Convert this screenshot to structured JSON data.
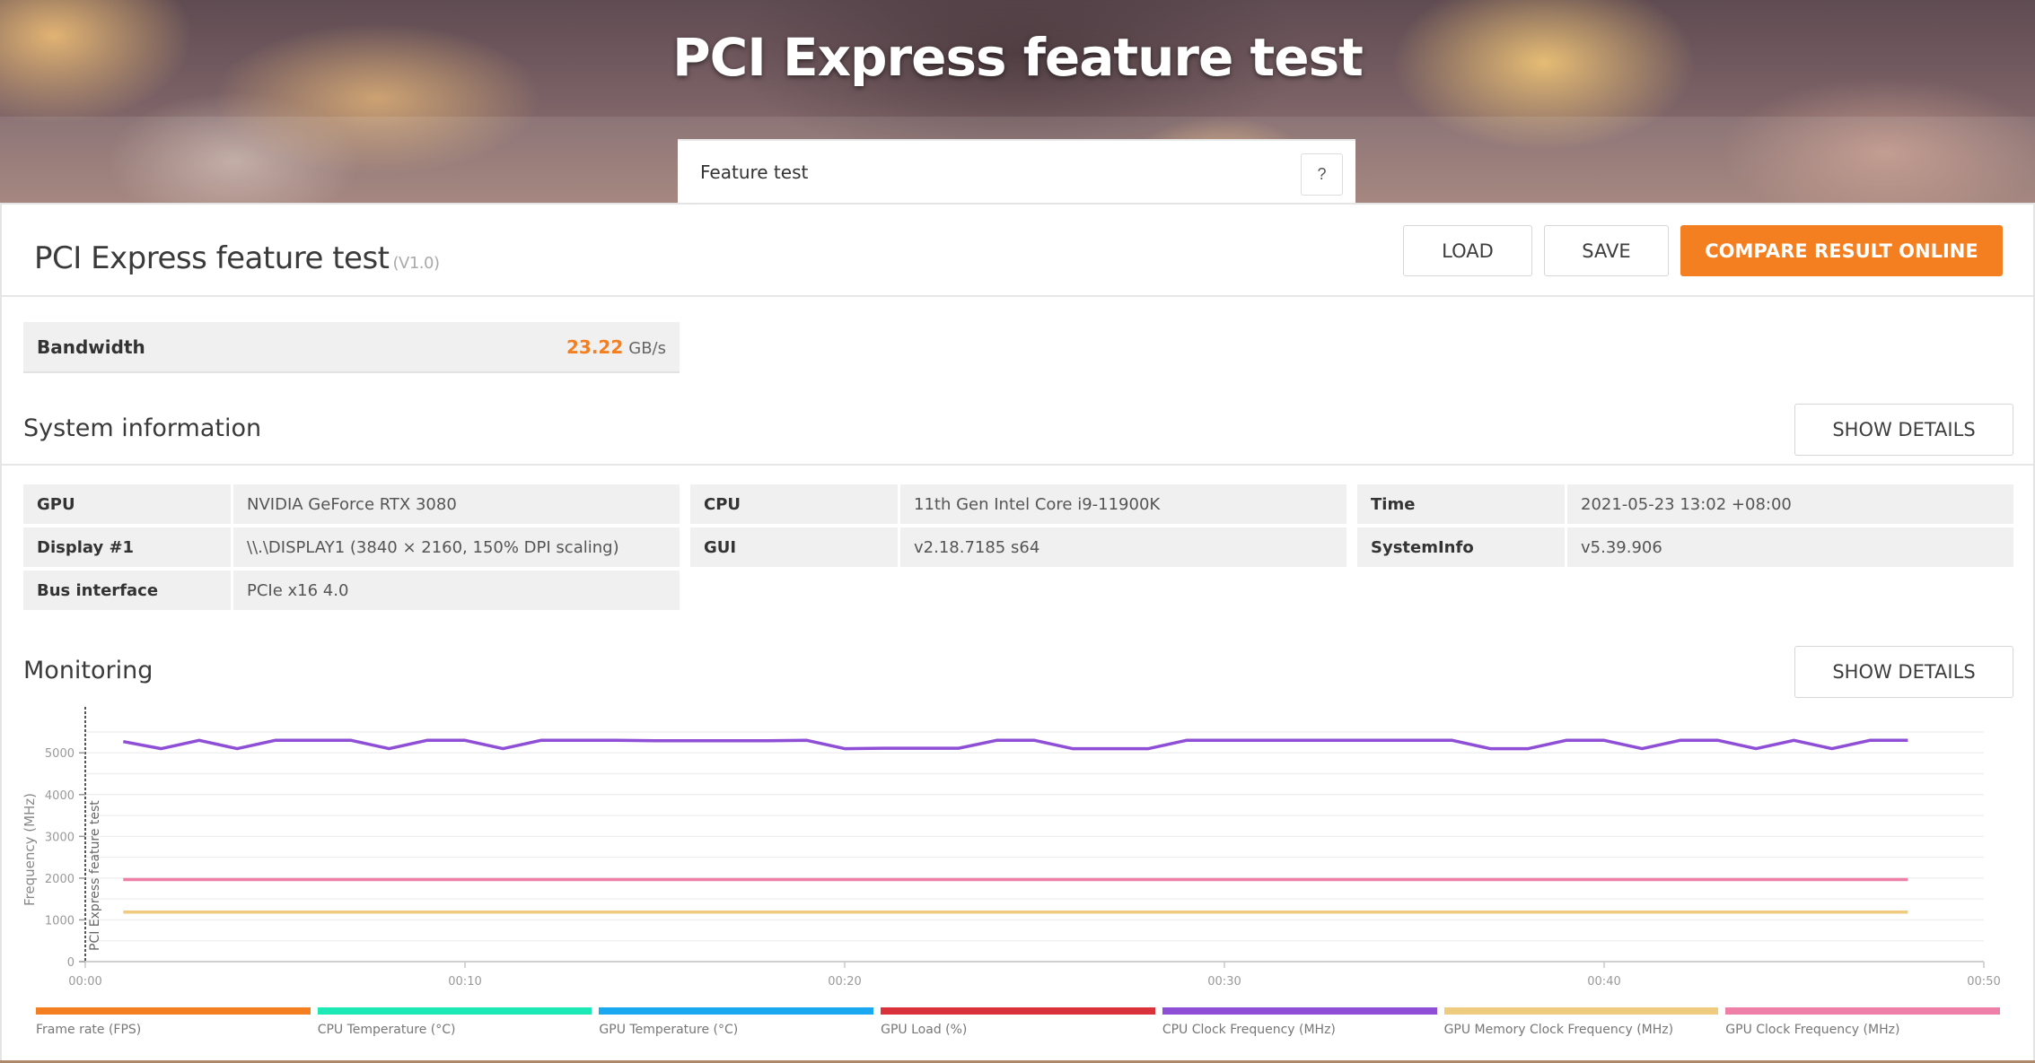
{
  "banner": {
    "title": "PCI Express feature test"
  },
  "tab": {
    "label": "Feature test",
    "help_label": "?"
  },
  "result": {
    "title": "PCI Express feature test",
    "version": "(V1.0)",
    "buttons": {
      "load": "LOAD",
      "save": "SAVE",
      "compare": "COMPARE RESULT ONLINE"
    },
    "accent_color": "#f47f20"
  },
  "bandwidth": {
    "label": "Bandwidth",
    "value": "23.22",
    "unit": "GB/s"
  },
  "system_information": {
    "title": "System information",
    "show_details": "SHOW DETAILS",
    "rows": [
      {
        "label": "GPU",
        "value": "NVIDIA GeForce RTX 3080"
      },
      {
        "label": "Display #1",
        "value": "\\\\.\\DISPLAY1 (3840 × 2160, 150% DPI scaling)"
      },
      {
        "label": "Bus interface",
        "value": "PCIe x16 4.0"
      },
      {
        "label": "CPU",
        "value": "11th Gen Intel Core i9-11900K"
      },
      {
        "label": "GUI",
        "value": "v2.18.7185 s64"
      },
      {
        "label": "Time",
        "value": "2021-05-23 13:02 +08:00"
      },
      {
        "label": "SystemInfo",
        "value": "v5.39.906"
      }
    ]
  },
  "monitoring": {
    "title": "Monitoring",
    "show_details": "SHOW DETAILS"
  },
  "chart_data": {
    "type": "line",
    "title": "",
    "xlabel": "",
    "ylabel": "Frequency (MHz)",
    "marker_label": "PCI Express feature test",
    "xlim": [
      0,
      50
    ],
    "ylim": [
      0,
      5800
    ],
    "x_ticks": [
      "00:00",
      "00:10",
      "00:20",
      "00:30",
      "00:40",
      "00:50"
    ],
    "x_tick_values": [
      0,
      10,
      20,
      30,
      40,
      50
    ],
    "y_ticks": [
      0,
      1000,
      2000,
      3000,
      4000,
      5000
    ],
    "grid": true,
    "legend_position": "bottom",
    "x": [
      1,
      2,
      3,
      4,
      5,
      6,
      7,
      8,
      9,
      10,
      11,
      12,
      13,
      14,
      15,
      16,
      17,
      18,
      19,
      20,
      21,
      22,
      23,
      24,
      25,
      26,
      27,
      28,
      29,
      30,
      31,
      32,
      33,
      34,
      35,
      36,
      37,
      38,
      39,
      40,
      41,
      42,
      43,
      44,
      45,
      46,
      47,
      48
    ],
    "series": [
      {
        "name": "Frame rate (FPS)",
        "color": "#f47f20",
        "values": []
      },
      {
        "name": "CPU Temperature (°C)",
        "color": "#1de9b6",
        "values": []
      },
      {
        "name": "GPU Temperature (°C)",
        "color": "#1aa9f0",
        "values": []
      },
      {
        "name": "GPU Load (%)",
        "color": "#d9323a",
        "values": []
      },
      {
        "name": "CPU Clock Frequency (MHz)",
        "color": "#8e4fd6",
        "values": [
          5270,
          5100,
          5300,
          5100,
          5300,
          5300,
          5300,
          5100,
          5300,
          5300,
          5100,
          5300,
          5300,
          5300,
          5290,
          5290,
          5290,
          5290,
          5300,
          5100,
          5110,
          5110,
          5110,
          5300,
          5300,
          5100,
          5100,
          5100,
          5300,
          5300,
          5300,
          5300,
          5300,
          5300,
          5300,
          5300,
          5100,
          5100,
          5300,
          5300,
          5100,
          5300,
          5300,
          5100,
          5300,
          5100,
          5300,
          5300
        ]
      },
      {
        "name": "GPU Memory Clock Frequency (MHz)",
        "color": "#eecb7e",
        "values": [
          1188,
          1188,
          1188,
          1188,
          1188,
          1188,
          1188,
          1188,
          1188,
          1188,
          1188,
          1188,
          1188,
          1188,
          1188,
          1188,
          1188,
          1188,
          1188,
          1188,
          1188,
          1188,
          1188,
          1188,
          1188,
          1188,
          1188,
          1188,
          1188,
          1188,
          1188,
          1188,
          1188,
          1188,
          1188,
          1188,
          1188,
          1188,
          1188,
          1188,
          1188,
          1188,
          1188,
          1188,
          1188,
          1188,
          1188,
          1188
        ]
      },
      {
        "name": "GPU Clock Frequency (MHz)",
        "color": "#ee7fa6",
        "values": [
          1965,
          1965,
          1965,
          1965,
          1965,
          1965,
          1965,
          1965,
          1965,
          1965,
          1965,
          1965,
          1965,
          1965,
          1965,
          1965,
          1965,
          1965,
          1965,
          1965,
          1965,
          1965,
          1965,
          1965,
          1965,
          1965,
          1965,
          1965,
          1965,
          1965,
          1965,
          1965,
          1965,
          1965,
          1965,
          1965,
          1965,
          1965,
          1965,
          1965,
          1965,
          1965,
          1965,
          1965,
          1965,
          1965,
          1965,
          1965
        ]
      }
    ]
  }
}
